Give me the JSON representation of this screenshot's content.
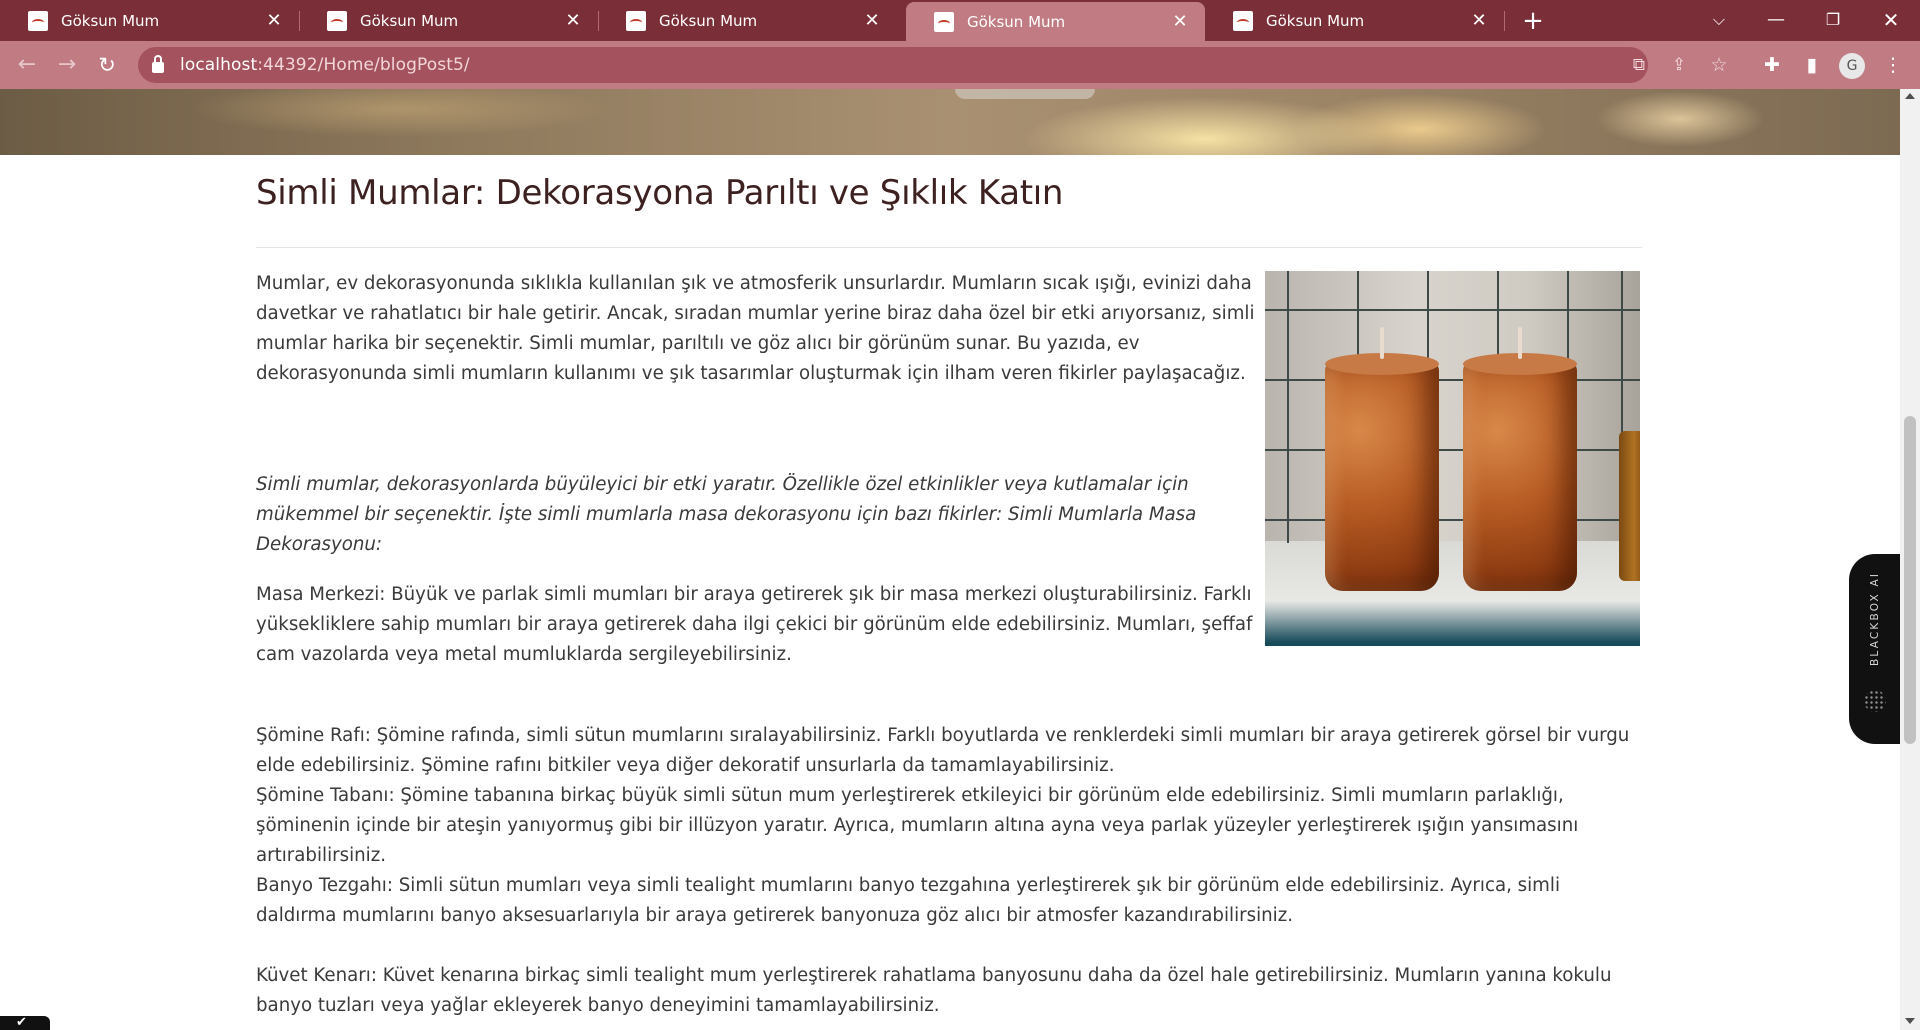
{
  "browser": {
    "tabs": [
      {
        "title": "Göksun Mum",
        "active": false
      },
      {
        "title": "Göksun Mum",
        "active": false
      },
      {
        "title": "Göksun Mum",
        "active": false
      },
      {
        "title": "Göksun Mum",
        "active": true
      },
      {
        "title": "Göksun Mum",
        "active": false
      }
    ],
    "url_host": "localhost",
    "url_rest": ":44392/Home/blogPost5/",
    "profile_initial": "G"
  },
  "article": {
    "title": "Simli Mumlar: Dekorasyona Parıltı ve Şıklık Katın",
    "paragraphs": {
      "intro": "Mumlar, ev dekorasyonunda sıklıkla kullanılan şık ve atmosferik unsurlardır. Mumların sıcak ışığı, evinizi daha davetkar ve rahatlatıcı bir hale getirir. Ancak, sıradan mumlar yerine biraz daha özel bir etki arıyorsanız, simli mumlar harika bir seçenektir. Simli mumlar, parıltılı ve göz alıcı bir görünüm sunar. Bu yazıda, ev dekorasyonunda simli mumların kullanımı ve şık tasarımlar oluşturmak için ilham veren fikirler paylaşacağız.",
      "italic": "Simli mumlar, dekorasyonlarda büyüleyici bir etki yaratır. Özellikle özel etkinlikler veya kutlamalar için mükemmel bir seçenektir. İşte simli mumlarla masa dekorasyonu için bazı fikirler: Simli Mumlarla Masa Dekorasyonu:",
      "masa": "Masa Merkezi: Büyük ve parlak simli mumları bir araya getirerek şık bir masa merkezi oluşturabilirsiniz. Farklı yüksekliklere sahip mumları bir araya getirerek daha ilgi çekici bir görünüm elde edebilirsiniz. Mumları, şeffaf cam vazolarda veya metal mumluklarda sergileyebilirsiniz.",
      "somine_rafi": "Şömine Rafı: Şömine rafında, simli sütun mumlarını sıralayabilirsiniz. Farklı boyutlarda ve renklerdeki simli mumları bir araya getirerek görsel bir vurgu elde edebilirsiniz. Şömine rafını bitkiler veya diğer dekoratif unsurlarla da tamamlayabilirsiniz.",
      "somine_tabani": "Şömine Tabanı: Şömine tabanına birkaç büyük simli sütun mum yerleştirerek etkileyici bir görünüm elde edebilirsiniz. Simli mumların parlaklığı, şöminenin içinde bir ateşin yanıyormuş gibi bir illüzyon yaratır. Ayrıca, mumların altına ayna veya parlak yüzeyler yerleştirerek ışığın yansımasını artırabilirsiniz.",
      "banyo": "Banyo Tezgahı: Simli sütun mumları veya simli tealight mumlarını banyo tezgahına yerleştirerek şık bir görünüm elde edebilirsiniz. Ayrıca, simli daldırma mumlarını banyo aksesuarlarıyla bir araya getirerek banyonuza göz alıcı bir atmosfer kazandırabilirsiniz.",
      "kuvet": "Küvet Kenarı: Küvet kenarına birkaç simli tealight mum yerleştirerek rahatlama banyosunu daha da özel hale getirebilirsiniz. Mumların yanına kokulu banyo tuzları veya yağlar ekleyerek banyo deneyimini tamamlayabilirsiniz."
    }
  },
  "widget": {
    "label": "BLACKBOX AI"
  },
  "colors": {
    "tabbar": "#7a2e37",
    "toolbar": "#c07b83",
    "title_text": "#3d2020",
    "body_text": "#3a3a3a"
  }
}
